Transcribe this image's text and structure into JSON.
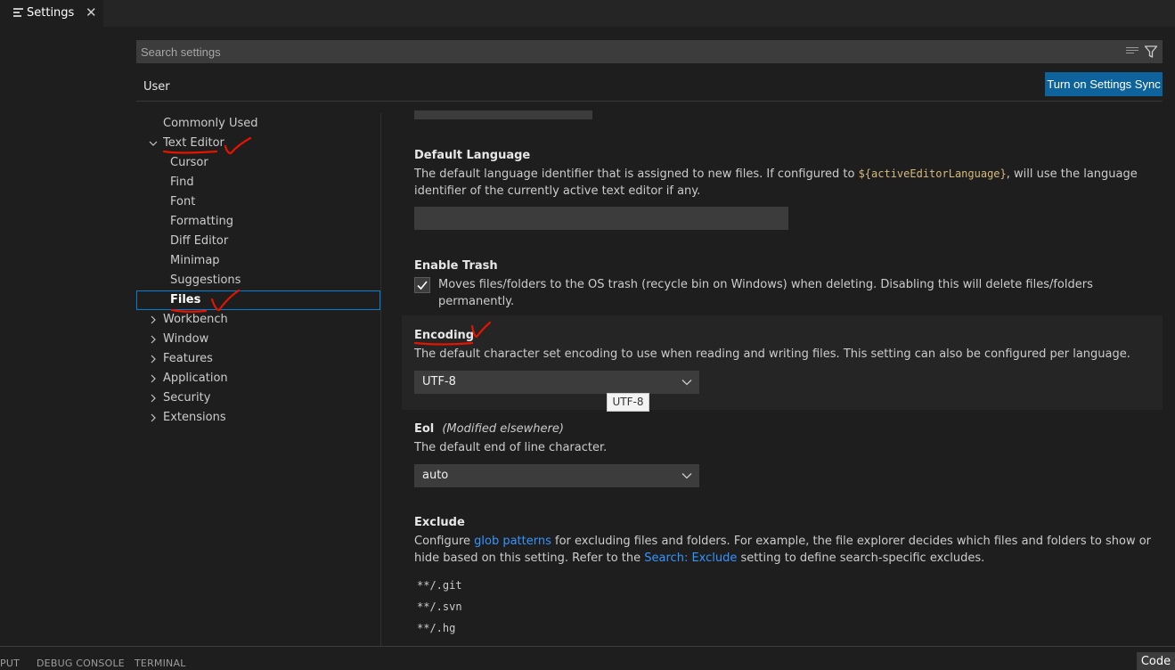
{
  "tab": {
    "title": "Settings",
    "close": "✕",
    "icon": "lines-icon"
  },
  "search": {
    "placeholder": "Search settings"
  },
  "scope": {
    "user": "User",
    "sync_button": "Turn on Settings Sync"
  },
  "toc": {
    "commonly_used": "Commonly Used",
    "text_editor": "Text Editor",
    "sub": [
      "Cursor",
      "Find",
      "Font",
      "Formatting",
      "Diff Editor",
      "Minimap",
      "Suggestions",
      "Files"
    ],
    "groups": [
      "Workbench",
      "Window",
      "Features",
      "Application",
      "Security",
      "Extensions"
    ]
  },
  "settings": {
    "default_language": {
      "title": "Default Language",
      "desc_before": "The default language identifier that is assigned to new files. If configured to ",
      "code": "${activeEditorLanguage}",
      "desc_after": ", will use the language identifier of the currently active text editor if any."
    },
    "enable_trash": {
      "title": "Enable Trash",
      "desc": "Moves files/folders to the OS trash (recycle bin on Windows) when deleting. Disabling this will delete files/folders permanently.",
      "checked": true
    },
    "encoding": {
      "title": "Encoding",
      "desc": "The default character set encoding to use when reading and writing files. This setting can also be configured per language.",
      "value": "UTF-8",
      "tooltip": "UTF-8"
    },
    "eol": {
      "title": "Eol",
      "modified": "(Modified elsewhere)",
      "desc": "The default end of line character.",
      "value": "auto"
    },
    "exclude": {
      "title": "Exclude",
      "desc_1": "Configure ",
      "link_1": "glob patterns",
      "desc_2": " for excluding files and folders. For example, the file explorer decides which files and folders to show or hide based on this setting. Refer to the ",
      "link_2": "Search: Exclude",
      "desc_3": " setting to define search-specific excludes.",
      "items": [
        "**/.git",
        "**/.svn",
        "**/.hg"
      ]
    }
  },
  "panel": {
    "tabs": [
      "PUT",
      "DEBUG CONSOLE",
      "TERMINAL"
    ],
    "code_button": "Code"
  },
  "colors": {
    "accent": "#0e639c",
    "annotation": "#e51400",
    "link": "#3794ff",
    "focus_border": "#007fd4"
  }
}
